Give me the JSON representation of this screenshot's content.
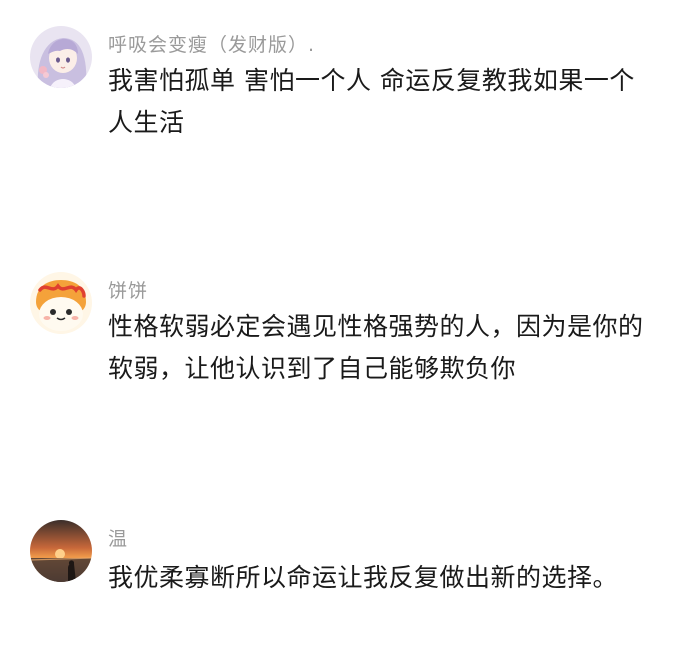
{
  "comments": [
    {
      "username": "呼吸会变瘦（发财版）.",
      "text": "我害怕孤单 害怕一个人 命运反复教我如果一个人生活",
      "avatar_icon": "anime-girl-avatar-icon"
    },
    {
      "username": "饼饼",
      "text": "性格软弱必定会遇见性格强势的人，因为是你的软弱，让他认识到了自己能够欺负你",
      "avatar_icon": "cat-bread-avatar-icon"
    },
    {
      "username": "温",
      "text": "我优柔寡断所以命运让我反复做出新的选择。",
      "avatar_icon": "sunset-avatar-icon"
    }
  ]
}
